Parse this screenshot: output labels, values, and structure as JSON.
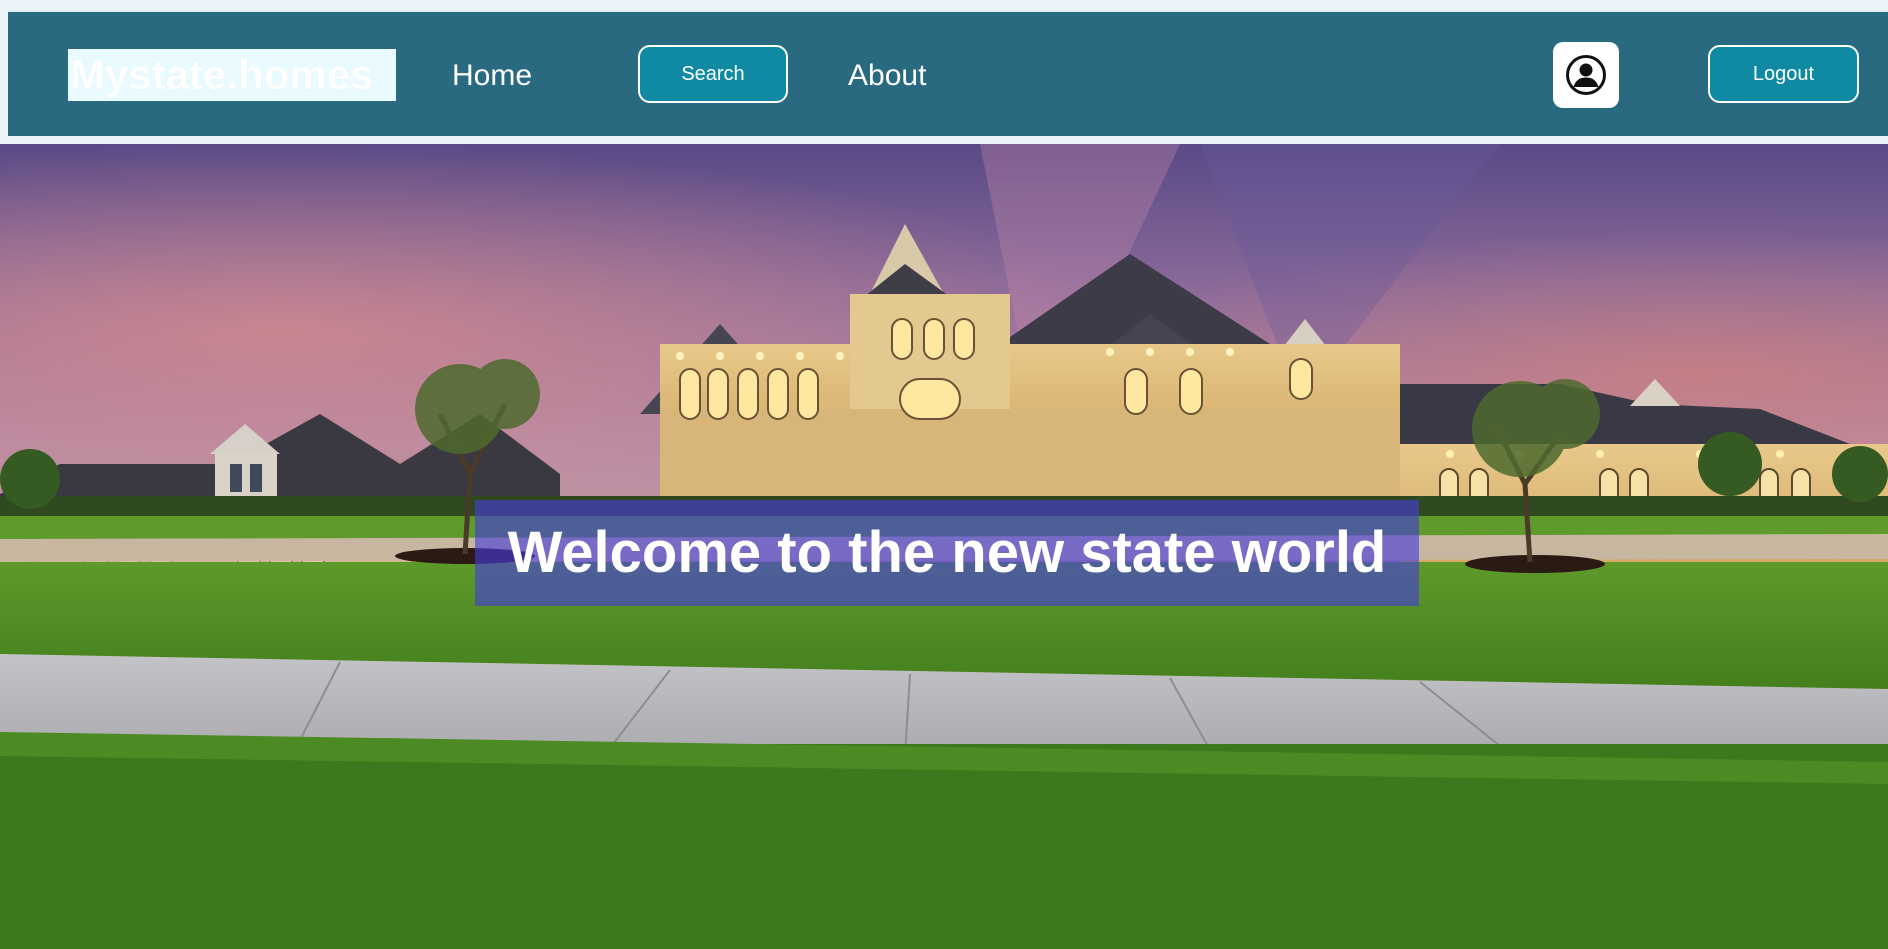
{
  "navbar": {
    "brand": "Mystate.homes",
    "links": {
      "home": "Home",
      "about": "About"
    },
    "search_button": "Search",
    "logout_button": "Logout",
    "profile_icon": "user-circle-icon"
  },
  "hero": {
    "headline": "Welcome to the new state world",
    "image": "illuminated-mansion-at-dusk"
  },
  "colors": {
    "navbar_bg": "#296a80",
    "button_bg": "#0f8aa2",
    "banner_bg": "#463cdc"
  }
}
